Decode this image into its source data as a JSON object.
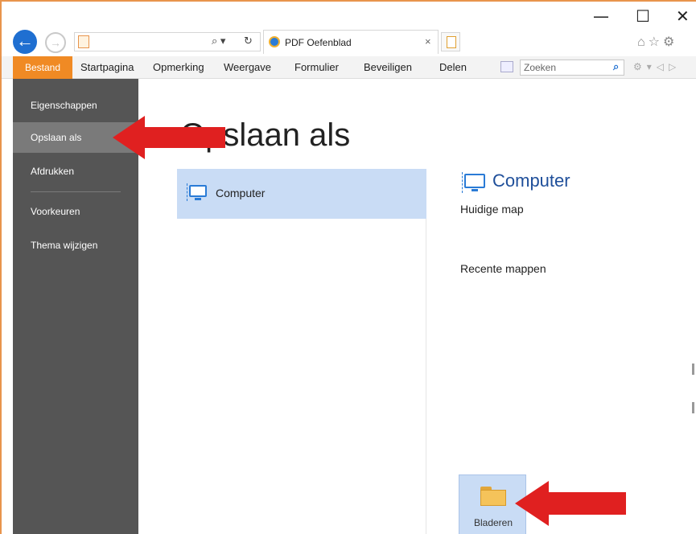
{
  "window": {
    "minimize_glyph": "—",
    "maximize_glyph": "☐",
    "close_glyph": "✕"
  },
  "navigation": {
    "back_icon": "arrow-left-icon",
    "forward_icon": "arrow-right-icon",
    "search_glyph": "⌕ ▾",
    "refresh_glyph": "↻",
    "tab": {
      "title": "PDF Oefenblad",
      "close_glyph": "×"
    },
    "browser_icons": "⌂☆⚙"
  },
  "menu": {
    "items": [
      "Bestand",
      "Startpagina",
      "Opmerking",
      "Weergave",
      "Formulier",
      "Beveiligen",
      "Delen"
    ],
    "active": "Bestand",
    "search_placeholder": "Zoeken",
    "tools_glyphs": "⚙▾◁▷"
  },
  "sidebar": {
    "items": [
      {
        "label": "Eigenschappen",
        "selected": false
      },
      {
        "label": "Opslaan als",
        "selected": true
      },
      {
        "label": "Afdrukken",
        "selected": false
      },
      {
        "label": "Voorkeuren",
        "selected": false
      },
      {
        "label": "Thema wijzigen",
        "selected": false
      }
    ]
  },
  "main": {
    "title": "Opslaan als",
    "places": [
      {
        "label": "Computer",
        "icon": "computer-icon",
        "selected": true
      }
    ],
    "detail": {
      "heading": "Computer",
      "current_folder_label": "Huidige map",
      "recent_folders_label": "Recente mappen",
      "browse_label": "Bladeren",
      "browse_icon": "folder-icon"
    }
  },
  "colors": {
    "accent_orange": "#f08a24",
    "sidebar_bg": "#555555",
    "sidebar_selected": "#7a7a7a",
    "selection_blue": "#c9dcf5",
    "heading_blue": "#1f4f9a",
    "annotation_red": "#e02020"
  }
}
